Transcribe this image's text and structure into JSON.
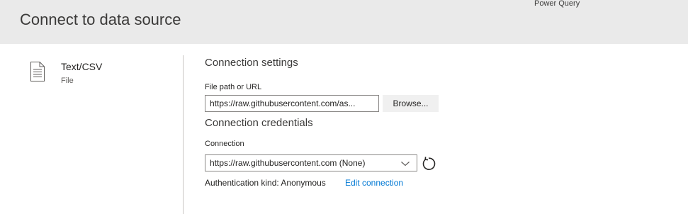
{
  "header": {
    "title": "Connect to data source",
    "app_name": "Power Query"
  },
  "source": {
    "icon": "document-icon",
    "name": "Text/CSV",
    "type": "File"
  },
  "connection_settings": {
    "heading": "Connection settings",
    "file_path_label": "File path or URL",
    "file_path_value": "https://raw.githubusercontent.com/as...",
    "browse_label": "Browse..."
  },
  "connection_credentials": {
    "heading": "Connection credentials",
    "connection_label": "Connection",
    "connection_value": "https://raw.githubusercontent.com (None)",
    "refresh_icon": "refresh-icon",
    "auth_kind_text": "Authentication kind: Anonymous",
    "edit_link_label": "Edit connection"
  },
  "colors": {
    "header_bg": "#eaeaea",
    "link": "#0078d4",
    "divider": "#c8c6c4",
    "input_border": "#8a8886"
  }
}
